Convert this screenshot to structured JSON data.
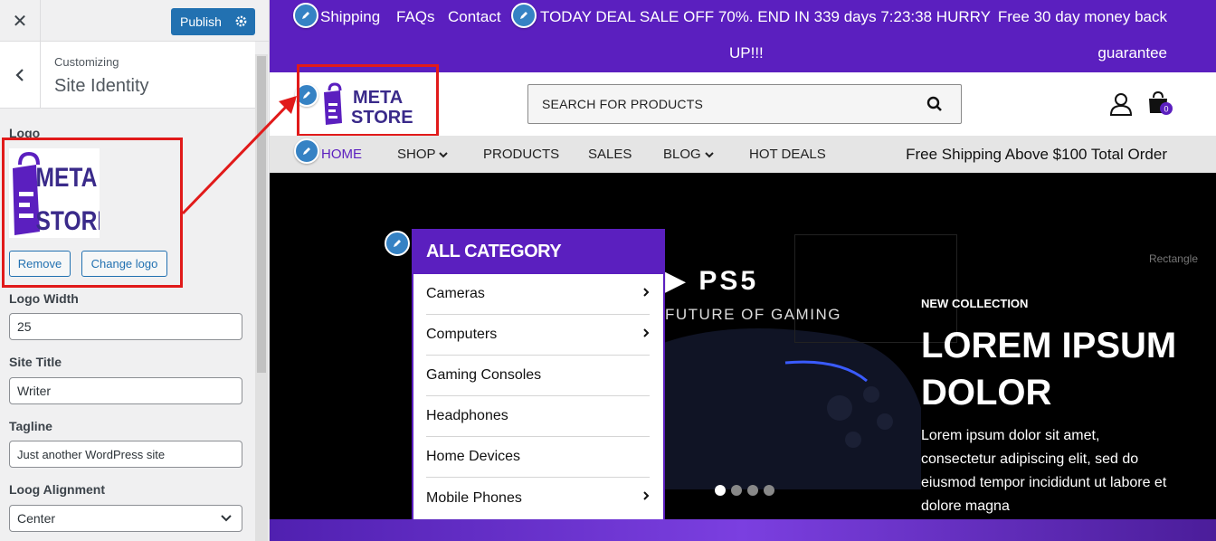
{
  "customizer": {
    "close_icon": "close-icon",
    "publish_label": "Publish",
    "breadcrumb": "Customizing",
    "section_title": "Site Identity",
    "logo_label": "Logo",
    "remove_label": "Remove",
    "change_logo_label": "Change logo",
    "logo_width_label": "Logo Width",
    "logo_width_value": "25",
    "site_title_label": "Site Title",
    "site_title_value": "Writer",
    "tagline_label": "Tagline",
    "tagline_value": "Just another WordPress site",
    "alignment_label": "Loog Alignment",
    "alignment_value": "Center"
  },
  "logo": {
    "line1": "META",
    "line2": "STORE"
  },
  "preview": {
    "topbar": {
      "links": [
        "Shipping",
        "FAQs",
        "Contact"
      ],
      "deal_line1": "TODAY DEAL SALE OFF 70%. END IN 339 days 7:23:38 HURRY",
      "deal_line2": "UP!!!",
      "money_line1": "Free 30 day money back",
      "money_line2": "guarantee"
    },
    "search_placeholder": "SEARCH FOR PRODUCTS",
    "cart_count": "0",
    "nav": {
      "items": [
        "HOME",
        "SHOP",
        "PRODUCTS",
        "SALES",
        "BLOG",
        "HOT DEALS"
      ],
      "shipping_note": "Free Shipping Above $100 Total Order"
    },
    "category": {
      "title": "ALL CATEGORY",
      "items": [
        "Cameras",
        "Computers",
        "Gaming Consoles",
        "Headphones",
        "Home Devices",
        "Mobile Phones"
      ]
    },
    "hero": {
      "ps5": "PS5",
      "tagline": "FUTURE OF GAMING",
      "rect_label": "Rectangle",
      "kicker": "NEW COLLECTION",
      "headline": "LOREM IPSUM DOLOR",
      "body": "Lorem ipsum dolor sit amet, consectetur adipiscing elit, sed do eiusmod tempor incididunt ut labore et dolore magna"
    }
  },
  "colors": {
    "brand_purple": "#5b1fbf",
    "wp_blue": "#2271b1",
    "highlight_red": "#e11a1a"
  }
}
